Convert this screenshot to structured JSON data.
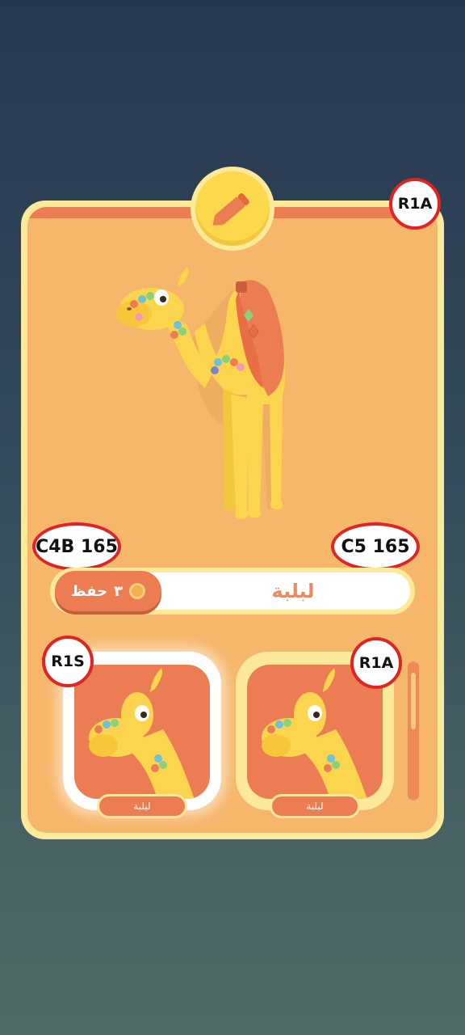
{
  "character": {
    "name": "لبلبة",
    "edit_icon": "pencil-icon"
  },
  "save": {
    "label": "حفظ",
    "price": "٣",
    "currency_icon": "coin-icon"
  },
  "tags": {
    "card_rarity": "R1A",
    "left_code": "C4B 165",
    "right_code": "C5 165",
    "selected_thumb": "R1S",
    "other_thumb": "R1A"
  },
  "gallery": [
    {
      "name": "لبلبة",
      "state": "selected"
    },
    {
      "name": "لبلبة",
      "state": "available"
    }
  ],
  "colors": {
    "card_border": "#fde99a",
    "card_fill": "#f7b76b",
    "accent": "#ec7c52",
    "camel": "#fbd54e",
    "name_text": "#e98a62"
  }
}
